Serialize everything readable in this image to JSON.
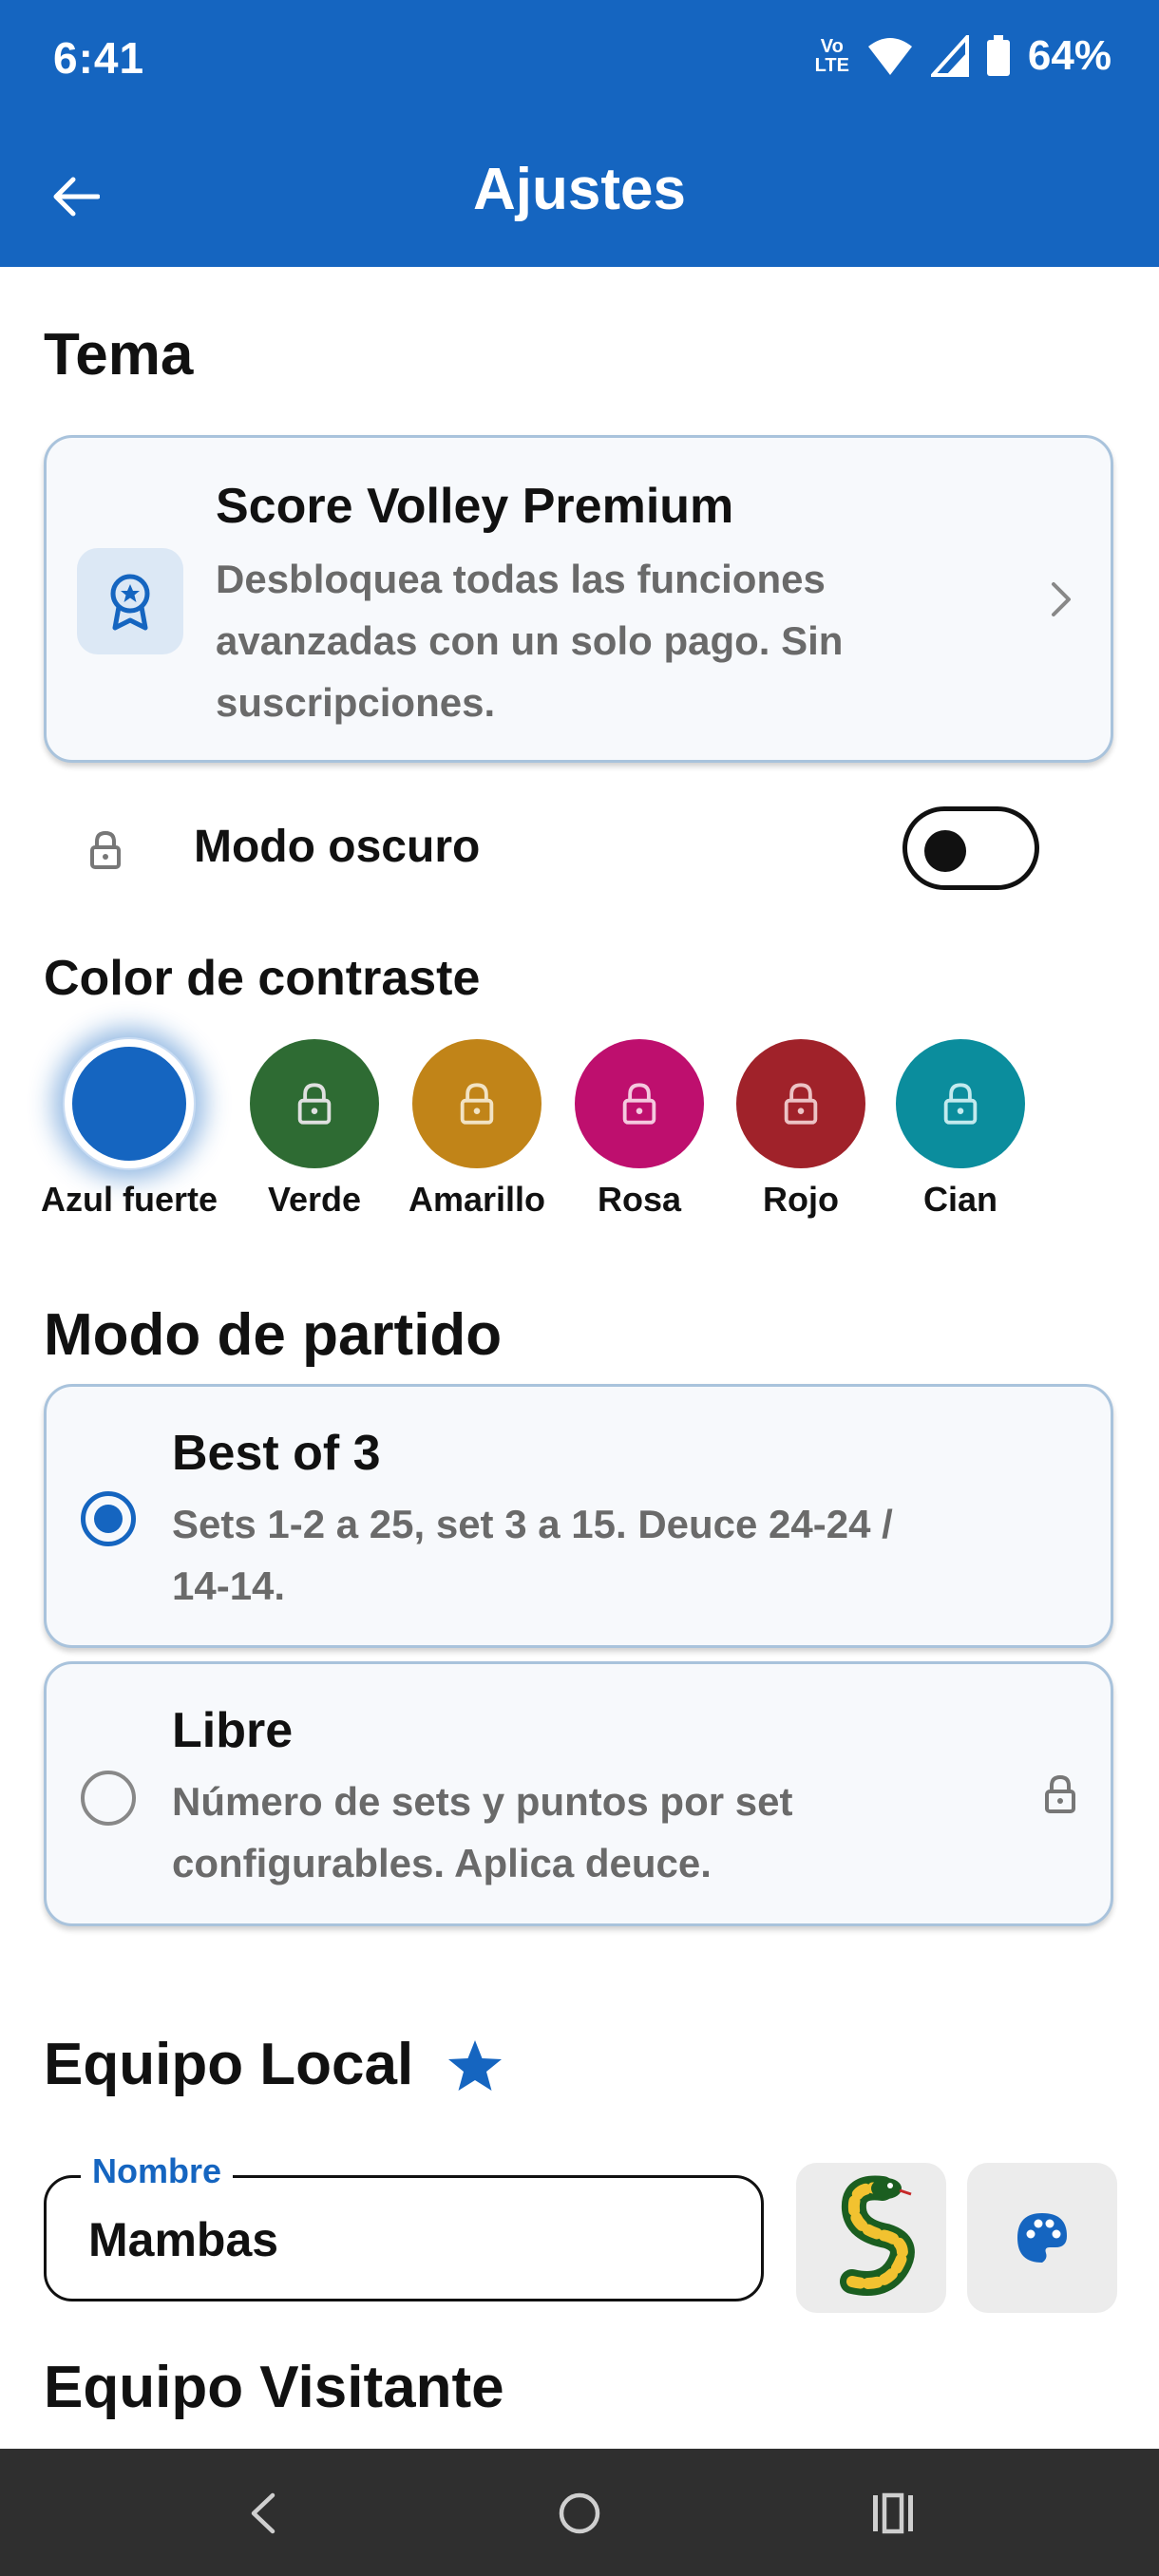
{
  "status": {
    "time": "6:41",
    "volte_top": "Vo",
    "volte_bottom": "LTE",
    "battery": "64%"
  },
  "appbar": {
    "title": "Ajustes",
    "back_icon": "arrow-left-icon"
  },
  "tema": {
    "title": "Tema",
    "premium": {
      "title": "Score Volley Premium",
      "desc_line1": "Desbloquea todas las funciones",
      "desc_line2": "avanzadas con un solo pago. Sin",
      "desc_line3": "suscripciones.",
      "icon": "award-badge-icon"
    },
    "dark_mode": {
      "label": "Modo oscuro",
      "enabled": false
    }
  },
  "contrast": {
    "title": "Color de contraste",
    "colors": [
      {
        "label": "Azul fuerte",
        "hex": "#1565C0",
        "selected": true,
        "locked": false
      },
      {
        "label": "Verde",
        "hex": "#2E6B33",
        "locked": true
      },
      {
        "label": "Amarillo",
        "hex": "#C18418",
        "locked": true
      },
      {
        "label": "Rosa",
        "hex": "#BE0F6E",
        "locked": true
      },
      {
        "label": "Rojo",
        "hex": "#A0222A",
        "locked": true
      },
      {
        "label": "Cian",
        "hex": "#0B8D9D",
        "locked": true
      }
    ]
  },
  "match_mode": {
    "title": "Modo de partido",
    "options": [
      {
        "title": "Best of 3",
        "desc_line1": "Sets 1-2 a 25, set 3 a 15. Deuce 24-24 /",
        "desc_line2": "14-14.",
        "selected": true
      },
      {
        "title": "Libre",
        "desc_line1": "Número de sets y puntos por set",
        "desc_line2": "configurables. Aplica deuce.",
        "selected": false,
        "locked": true
      }
    ]
  },
  "local_team": {
    "title": "Equipo Local",
    "name_label": "Nombre",
    "name_value": "Mambas",
    "logo_icon": "snake-icon",
    "palette_icon": "palette-icon"
  },
  "visitor_team": {
    "title": "Equipo Visitante"
  },
  "colors": {
    "primary": "#1565C0",
    "nav_bg": "#2f2f2f"
  }
}
